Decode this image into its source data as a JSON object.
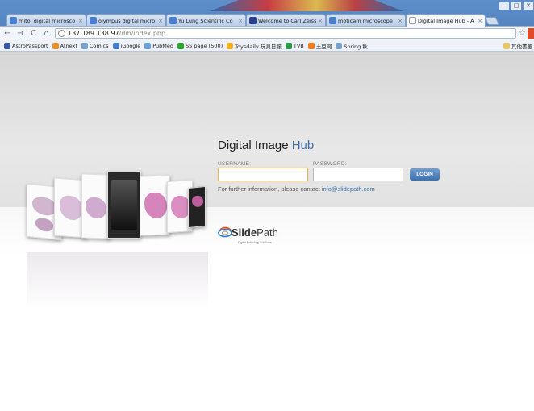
{
  "browser": {
    "tabs": [
      {
        "label": "mito, digital microsco",
        "favicon_color": "#4a7fd0"
      },
      {
        "label": "olympus digital micro",
        "favicon_color": "#4a7fd0"
      },
      {
        "label": "Yu Lung Scientific Co",
        "favicon_color": "#4a7fd0"
      },
      {
        "label": "Welcome to Carl Zeiss",
        "favicon_color": "#2b3f8c"
      },
      {
        "label": "moticam microscope",
        "favicon_color": "#4a7fd0"
      },
      {
        "label": "Digital Image Hub - A",
        "favicon_color": "#ffffff",
        "active": true
      }
    ],
    "window_controls": [
      "–",
      "□",
      "✕"
    ],
    "address": {
      "host": "137.189.138.97",
      "path": "/dih/index.php"
    },
    "bookmarks": [
      {
        "label": "AstroPassport",
        "color": "#3a5aa8"
      },
      {
        "label": "Atnext",
        "color": "#e8902a"
      },
      {
        "label": "Comics",
        "color": "#7aa2c8"
      },
      {
        "label": "iGoogle",
        "color": "#4a7fd0"
      },
      {
        "label": "PubMed",
        "color": "#6ca2d8"
      },
      {
        "label": "SS page (500)",
        "color": "#2fa62f"
      },
      {
        "label": "Toysdaily 玩具日報",
        "color": "#f0b020"
      },
      {
        "label": "TVB",
        "color": "#2a9a4a"
      },
      {
        "label": "土豆网",
        "color": "#f07a20"
      },
      {
        "label": "Spring 秋",
        "color": "#7aa2c8"
      }
    ],
    "other_bookmarks": "其他書籤"
  },
  "page": {
    "title_main": "Digital Image ",
    "title_accent": "Hub",
    "username_label": "USERNAME:",
    "password_label": "PASSWORD:",
    "username_value": "",
    "password_value": "",
    "login_label": "LOGIN",
    "info_text": "For further information, please contact ",
    "info_email": "info@slidepath.com",
    "logo_bold": "Slide",
    "logo_rest": "Path",
    "logo_tagline": "Digital Pathology Solutions"
  },
  "colors": {
    "accent": "#3d6fa8",
    "login_button": "#4f80bb"
  }
}
